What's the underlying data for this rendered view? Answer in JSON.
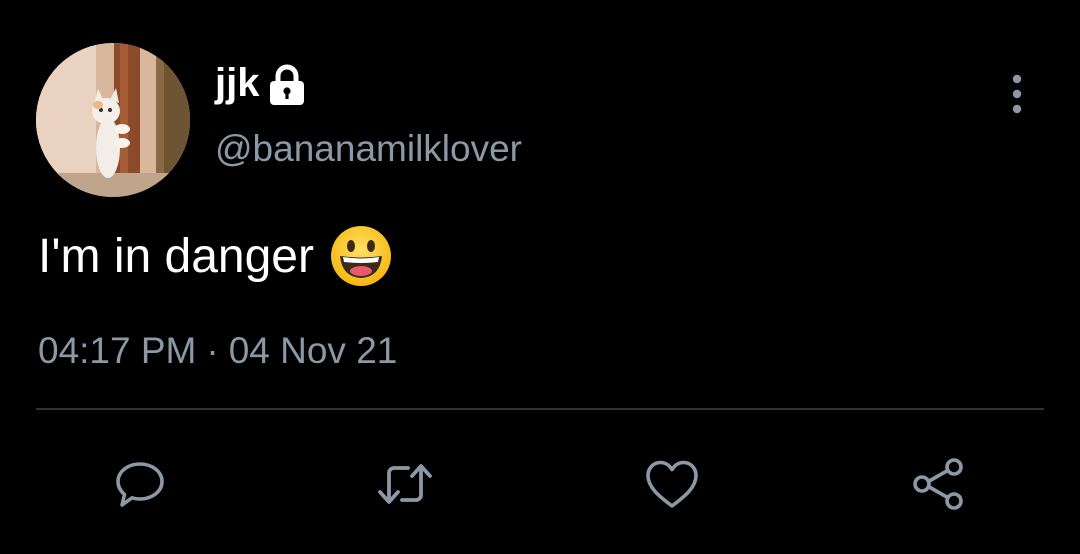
{
  "tweet": {
    "author": {
      "display_name": "jjk",
      "handle": "@bananamilklover",
      "protected_icon": "lock-icon",
      "avatar_description_icon": "kitten-avatar"
    },
    "text": "I'm in danger",
    "emoji": "grinning-face-emoji",
    "time": "04:17 PM",
    "separator": "·",
    "date": "04 Nov 21"
  },
  "actions": [
    {
      "name": "reply",
      "icon": "reply-icon"
    },
    {
      "name": "retweet",
      "icon": "retweet-icon"
    },
    {
      "name": "like",
      "icon": "heart-icon"
    },
    {
      "name": "share",
      "icon": "share-icon"
    }
  ],
  "colors": {
    "background": "#000000",
    "primary_text": "#ffffff",
    "secondary_text": "#8b98a5",
    "divider": "#2f3336",
    "icon": "#8b98a5"
  }
}
